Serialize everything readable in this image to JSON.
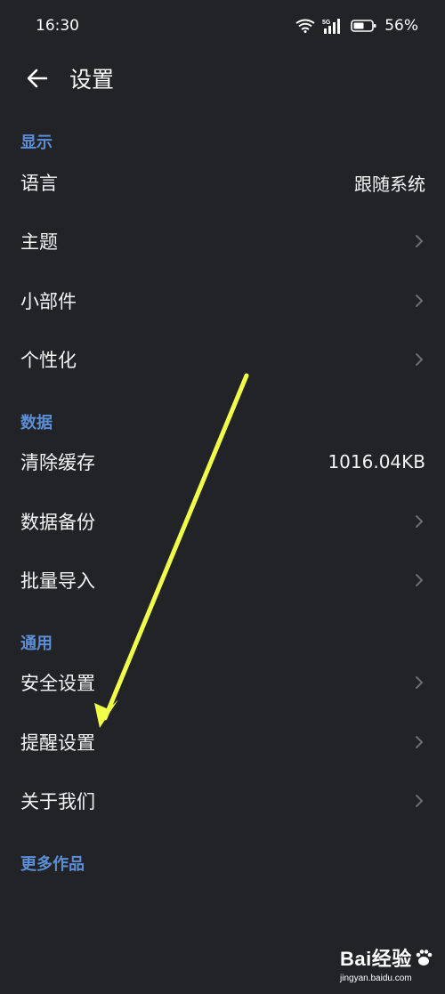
{
  "status_bar": {
    "time": "16:30",
    "network": "5G",
    "battery": "56%"
  },
  "header": {
    "title": "设置",
    "back_icon": "arrow-left-icon"
  },
  "sections": [
    {
      "title": "显示",
      "items": [
        {
          "label": "语言",
          "value": "跟随系统"
        },
        {
          "label": "主题"
        },
        {
          "label": "小部件"
        },
        {
          "label": "个性化"
        }
      ]
    },
    {
      "title": "数据",
      "items": [
        {
          "label": "清除缓存",
          "value": "1016.04KB"
        },
        {
          "label": "数据备份"
        },
        {
          "label": "批量导入"
        }
      ]
    },
    {
      "title": "通用",
      "items": [
        {
          "label": "安全设置"
        },
        {
          "label": "提醒设置"
        },
        {
          "label": "关于我们"
        }
      ]
    }
  ],
  "more_works": "更多作品",
  "watermark": {
    "brand": "Bai经验",
    "url": "jingyan.baidu.com"
  },
  "colors": {
    "background": "#222327",
    "section_title": "#5b8ed6",
    "annotation_arrow": "#f2ff4a"
  }
}
